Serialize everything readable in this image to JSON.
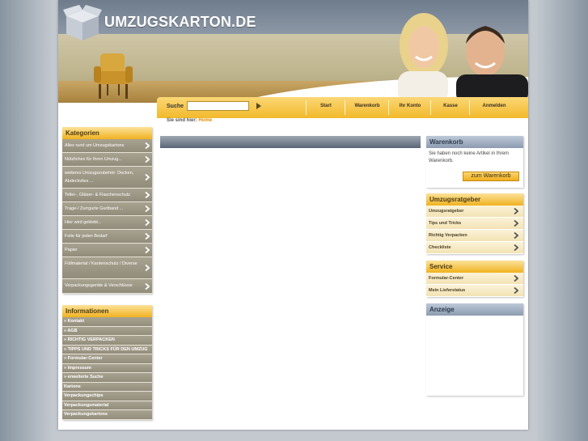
{
  "header": {
    "logo_text": "UMZUGSKARTON.DE",
    "search_label": "Suche",
    "search_value": "",
    "nav": [
      "Start",
      "Warenkorb",
      "Ihr Konto",
      "Kasse",
      "Anmelden"
    ]
  },
  "breadcrumb": {
    "prefix": "Sie sind hier:",
    "home": "Home"
  },
  "categories": {
    "title": "Kategorien",
    "items": [
      "Alles rund um Umzugskartons",
      "Nützliches für Ihren Umzug...",
      "weiteres Umzugszubehör: Decken, Abdeckvlies ...",
      "Teller-, Gläser- & Flaschenschutz",
      "Trage-/ Zurrgurte Gurtband ...",
      "Hier wird geklebt...",
      "Folie für jeden Bedarf",
      "Papier",
      "Füllmaterial / Kantenschutz / Diverse",
      "Verpackungsgeräte & Verschlüsse"
    ]
  },
  "informationen": {
    "title": "Informationen",
    "items": [
      "» Kontakt",
      "» AGB",
      "» RICHTIG VERPACKEN",
      "» TIPPS UND TRICKS FÜR DEN UMZUG",
      "» Formular-Center",
      "» Impressum",
      "» erweiterte Suche",
      "Kartons",
      "Verpackungschips",
      "Verpackungsmaterial",
      "Verpackungskartons"
    ]
  },
  "warenkorb": {
    "title": "Warenkorb",
    "text": "Sie haben noch keine Artikel in Ihrem Warenkorb.",
    "button": "zum Warenkorb"
  },
  "umzugsratgeber": {
    "title": "Umzugsratgeber",
    "items": [
      "Umzugsratgeber",
      "Tips und Tricks",
      "Richtig Verpacken",
      "Checkliste"
    ]
  },
  "service": {
    "title": "Service",
    "items": [
      "Formular-Center",
      "Mein Lieferstatus"
    ]
  },
  "anzeige": {
    "title": "Anzeige"
  },
  "colors": {
    "accent": "#f2b92b",
    "sidebar_item": "#a29c8a",
    "header_blue": "#6e7c8c"
  }
}
